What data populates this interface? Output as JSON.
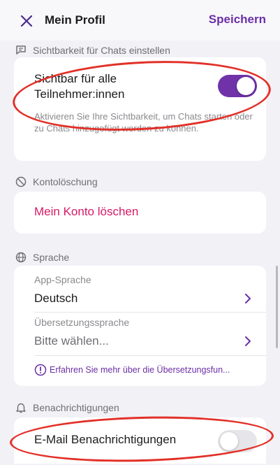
{
  "header": {
    "title": "Mein Profil",
    "save_label": "Speichern",
    "close_icon": "close-icon"
  },
  "chat_visibility": {
    "section_title": "Sichtbarkeit für Chats einstellen",
    "toggle_label": "Sichtbar für alle Teilnehmer:innen",
    "toggle_on": true,
    "hint": "Aktivieren Sie Ihre Sichtbarkeit, um Chats starten oder zu Chats hinzugefügt werden zu können."
  },
  "account_deletion": {
    "section_title": "Kontolöschung",
    "delete_label": "Mein Konto löschen"
  },
  "language": {
    "section_title": "Sprache",
    "app_language_label": "App-Sprache",
    "app_language_value": "Deutsch",
    "translation_label": "Übersetzungssprache",
    "translation_placeholder": "Bitte wählen...",
    "info_link": "Erfahren Sie mehr über die Übersetzungsfun..."
  },
  "notifications": {
    "section_title": "Benachrichtigungen",
    "email_label": "E-Mail Benachrichtigungen",
    "email_on": false
  },
  "colors": {
    "accent": "#6f32a8",
    "danger": "#d61a63",
    "annotation": "#e23028"
  }
}
